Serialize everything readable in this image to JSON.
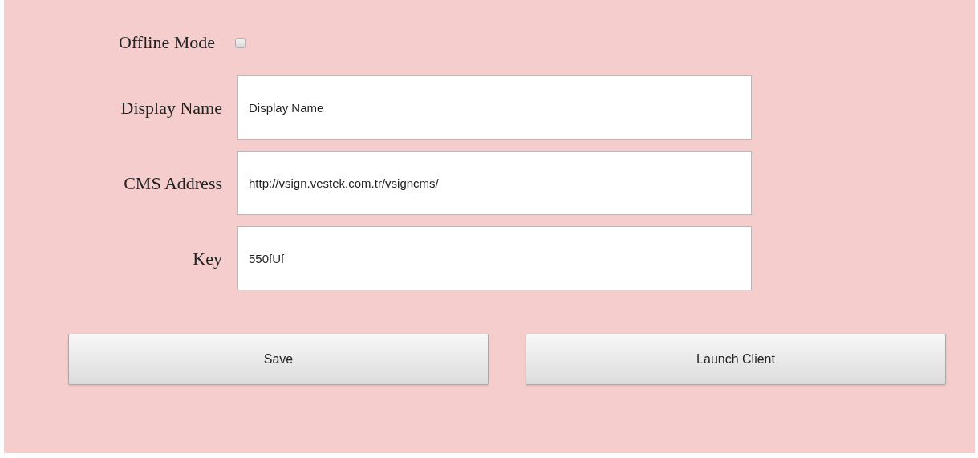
{
  "offline_mode": {
    "label": "Offline Mode",
    "checked": false
  },
  "fields": [
    {
      "label": "Display Name",
      "value": "Display Name"
    },
    {
      "label": "CMS Address",
      "value": "http://vsign.vestek.com.tr/vsigncms/"
    },
    {
      "label": "Key",
      "value": "550fUf"
    }
  ],
  "buttons": [
    "Save",
    "Launch Client"
  ]
}
